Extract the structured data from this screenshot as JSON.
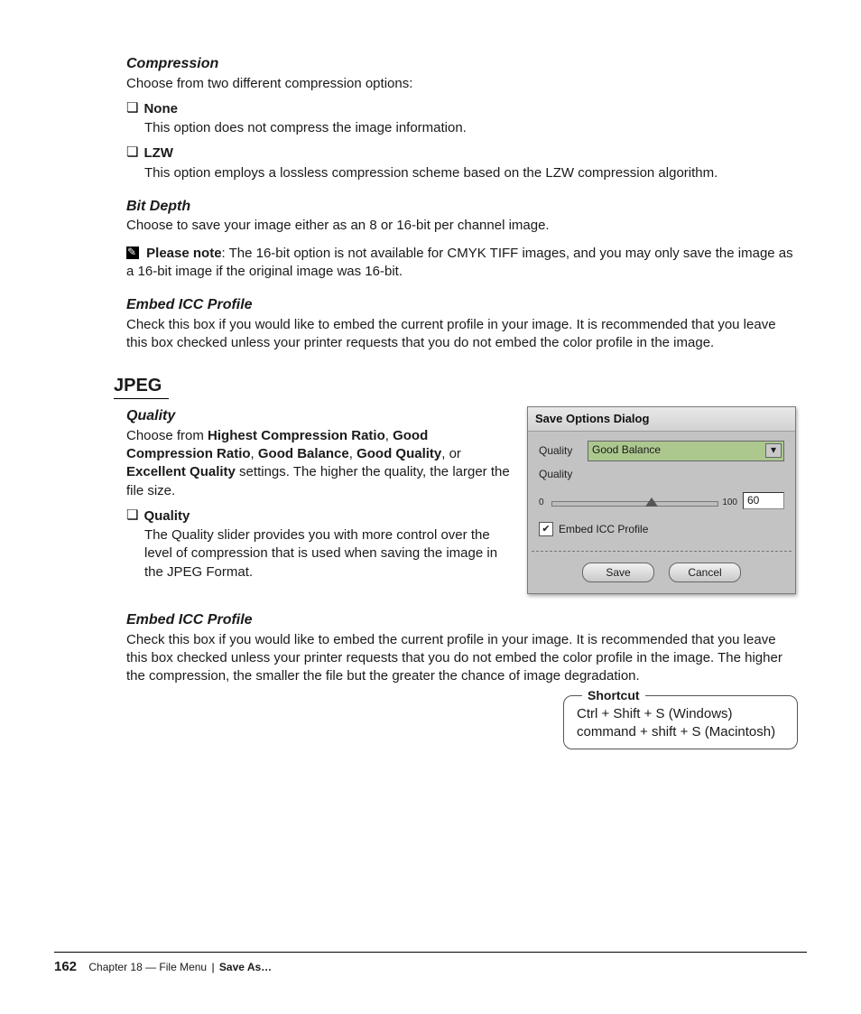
{
  "sections": {
    "compression": {
      "heading": "Compression",
      "body": "Choose from two different compression options:",
      "options": [
        {
          "name": "None",
          "desc": "This option does not compress the image information."
        },
        {
          "name": "LZW",
          "desc": "This option employs a lossless compression scheme based on the LZW compression algorithm."
        }
      ]
    },
    "bitdepth": {
      "heading": "Bit Depth",
      "body": "Choose to save your image either as an 8 or 16-bit per channel image.",
      "note_label": "Please note",
      "note_text": ": The 16-bit option is not available for CMYK TIFF images, and you may only save the image as a 16-bit image if the original image was 16-bit."
    },
    "icc": {
      "heading": "Embed ICC Profile",
      "body": "Check this box if you would like to embed the current profile in your image. It is recommended that you leave this box checked unless your printer requests that you do not embed the color profile in the image."
    },
    "jpeg_heading": "JPEG",
    "quality": {
      "heading": "Quality",
      "pre": "Choose from ",
      "b1": "Highest Compression Ratio",
      "c1": ", ",
      "b2": "Good Compression Ratio",
      "c2": ", ",
      "b3": "Good Balance",
      "c3": ", ",
      "b4": "Good Quality",
      "c4": ", or ",
      "b5": "Excellent Quality",
      "post": " settings. The higher the quality, the larger the file size.",
      "bullet_title": "Quality",
      "bullet_desc": "The Quality slider provides you with more control over the level of compression that is used when saving the image in the JPEG Format."
    },
    "icc2": {
      "heading": "Embed ICC Profile",
      "body": "Check this box if you would like to embed the current profile in your image. It is recommended that you leave this box checked unless your printer requests that you do not embed the color profile in the image. The higher the compression, the smaller the file but the greater the chance of image degradation."
    }
  },
  "dialog": {
    "title": "Save Options Dialog",
    "quality_label": "Quality",
    "quality_value": "Good Balance",
    "slider_label": "Quality",
    "slider_min": "0",
    "slider_max": "100",
    "slider_value": "60",
    "checkbox_mark": "✔",
    "checkbox_label": "Embed ICC Profile",
    "save": "Save",
    "cancel": "Cancel"
  },
  "shortcut": {
    "legend": "Shortcut",
    "win": "Ctrl + Shift + S (Windows)",
    "mac": "command + shift + S (Macintosh)"
  },
  "footer": {
    "page": "162",
    "chapter": "Chapter 18 — File Menu",
    "section": "Save As…"
  }
}
